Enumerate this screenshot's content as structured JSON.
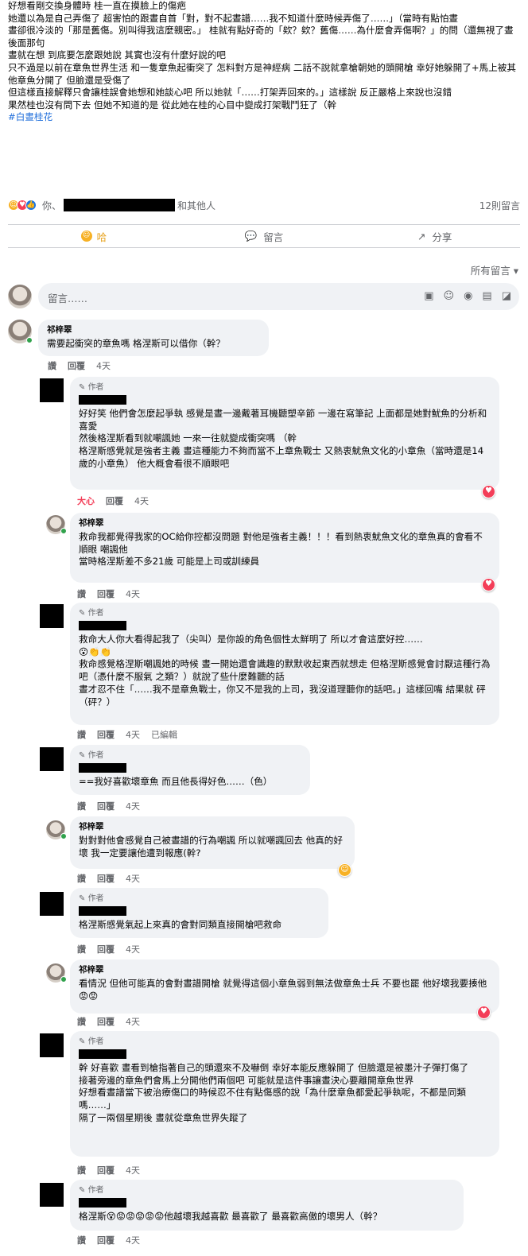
{
  "post": {
    "lines": [
      "好想看剛交換身體時 桂一直在摸臉上的傷疤",
      "她還以為是自己弄傷了 超害怕的跟晝自首「對，對不起晝譜……我不知道什麼時候弄傷了……」（當時有點怕晝",
      "晝卻很冷淡的「那是舊傷。別叫得我這麼親密。」 桂就有點好奇的「欸？欸？舊傷……為什麼會弄傷啊？」的問（還無視了晝後面那句",
      "晝就在想 到底要怎麼跟她說 其實也沒有什麼好說的吧",
      "只不過是以前在章魚世界生活 和一隻章魚起衝突了 怎料對方是神經病 二話不說就拿槍朝她的頭開槍 幸好她躲開了+馬上被其他章魚分開了 但臉還是受傷了",
      "但這樣直接解釋只會讓桂誤會她想和她談心吧 所以她就「……打架弄回來的。」這樣說 反正嚴格上來說也沒錯",
      "果然桂也沒有問下去 但她不知道的是 從此她在桂的心目中變成打架戰鬥狂了（幹"
    ],
    "hashtag": "#白晝桂花"
  },
  "reactions": {
    "you": "你、",
    "others": "和其他人",
    "count": "12則留言"
  },
  "actions": {
    "haha": "哈",
    "comment": "留言",
    "share": "分享"
  },
  "sort_label": "所有留言 ▾",
  "comment_input": {
    "placeholder": "留言……"
  },
  "labels": {
    "author": "作者",
    "like": "讚",
    "reply": "回覆",
    "love": "大心",
    "edited": "已編輯"
  },
  "comments": [
    {
      "name": "祁梓翠",
      "time": "4天",
      "text": "需要起衝突的章魚嗎 格涅斯可以借你（幹？"
    },
    {
      "time": "4天",
      "text": "好好笑 他們會怎麼起爭執 感覺是晝一邊戴著耳機聽塑辛節 一邊在寫筆記 上面都是她對魷魚的分析和喜愛\n然後格涅斯看到就嘲諷她 一來一往就變成衝突嗎 （幹\n格涅斯感覺就是強者主義 晝這種能力不夠而當不上章魚戰士 又熱衷魷魚文化的小章魚（當時還是14歲的小章魚） 他大概會看很不順眼吧"
    },
    {
      "name": "祁梓翠",
      "time": "4天",
      "text": "救命我都覺得我家的OC給你控都沒問題 對他是強者主義！！！看到熱衷魷魚文化的章魚真的會看不順眼 嘲諷他\n當時格涅斯差不多21歲 可能是上司或訓練員"
    },
    {
      "time": "4天",
      "text": "救命大人你大看得起我了（尖叫）是你設的角色個性太鮮明了 所以才會這麼好控……\n😮👏👏\n救命感覺格涅斯嘲諷她的時候 晝一開始還會識趣的默默收起東西就想走 但格涅斯感覺會討厭這種行為吧（憑什麼不服氣 之類？）就說了些什麼難聽的話\n晝才忍不住「……我不是章魚戰士，你又不是我的上司，我沒道理聽你的話吧。」這樣回嘴 結果就 砰（砰？）"
    },
    {
      "time": "4天",
      "text": "==我好喜歡壞章魚 而且他長得好色……（色）"
    },
    {
      "name": "祁梓翠",
      "time": "4天",
      "text": "對對對他會感覺自己被晝譜的行為嘲諷 所以就嘲諷回去 他真的好壞 我一定要讓他遭到報應(幹?"
    },
    {
      "time": "4天",
      "text": "格涅斯感覺氣起上來真的會對同類直接開槍吧救命"
    },
    {
      "name": "祁梓翠",
      "time": "4天",
      "text": "看情況 但他可能真的會對晝譜開槍 就覺得這個小章魚弱到無法做章魚士兵 不要也罷 他好壞我要揍他😡😡"
    },
    {
      "time": "4天",
      "text": "幹 好喜歡 晝看到槍指著自己的頭還來不及嚇倒 幸好本能反應躲開了 但臉還是被墨汁子彈打傷了\n接著旁邊的章魚們會馬上分開他們兩個吧 可能就是這件事讓晝決心要離開章魚世界\n好想看晝譜當下被治療傷口的時候忍不住有點傷感的說「為什麼章魚都愛起爭執呢，不都是同類嗎……」\n隔了一兩個星期後 晝就從章魚世界失蹤了"
    },
    {
      "time": "4天",
      "text": "格涅斯😵😡😡😡😡😡他越壞我越喜歡 最喜歡了 最喜歡高傲的壞男人（幹？"
    }
  ]
}
